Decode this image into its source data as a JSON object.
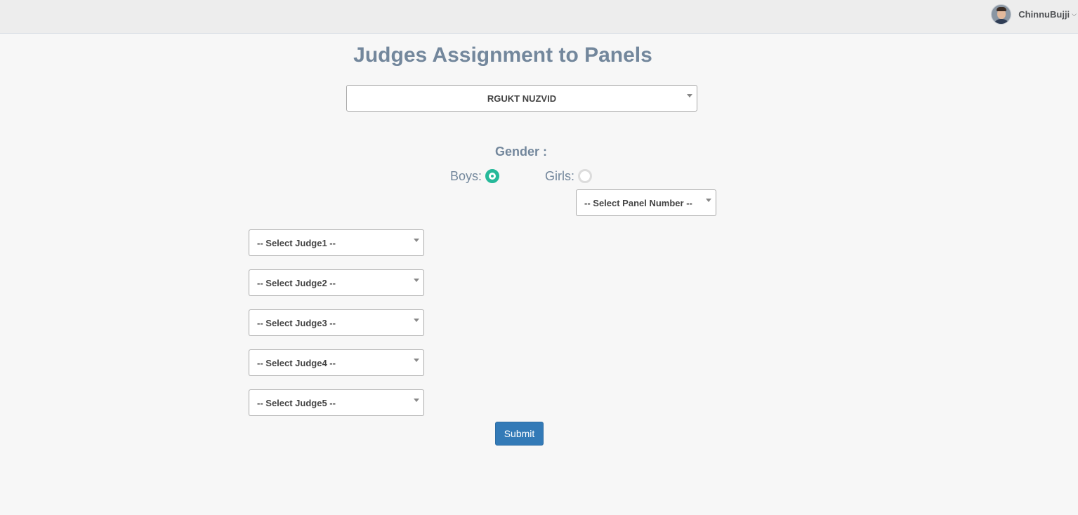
{
  "header": {
    "username": "ChinnuBujji",
    "caret_icon": "chevron-down-icon"
  },
  "page": {
    "title": "Judges Assignment to Panels"
  },
  "form": {
    "college_select": {
      "value": "RGUKT NUZVID"
    },
    "gender": {
      "label": "Gender :",
      "options": [
        {
          "label": "Boys:",
          "checked": true
        },
        {
          "label": "Girls:",
          "checked": false
        }
      ]
    },
    "panel_select": {
      "value": "-- Select Panel Number --"
    },
    "judges": [
      {
        "value": "-- Select Judge1 --"
      },
      {
        "value": "-- Select Judge2 --"
      },
      {
        "value": "-- Select Judge3 --"
      },
      {
        "value": "-- Select Judge4 --"
      },
      {
        "value": "-- Select Judge5 --"
      }
    ],
    "submit_label": "Submit"
  },
  "colors": {
    "accent_green": "#26b99a",
    "primary_blue": "#337ab7",
    "title_gray": "#73879c"
  }
}
